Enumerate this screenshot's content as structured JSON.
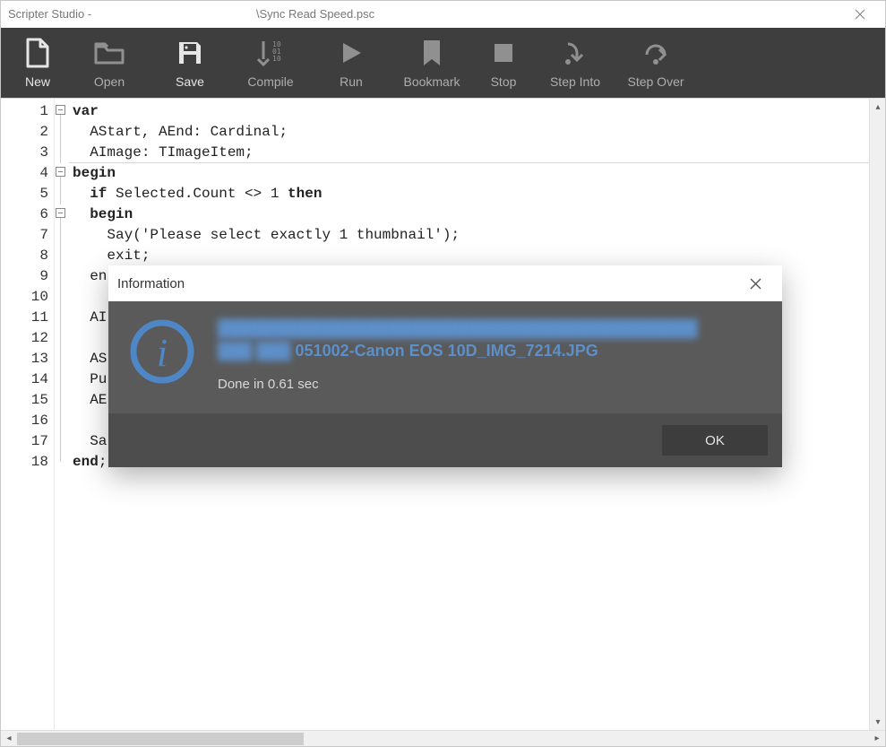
{
  "window": {
    "title_prefix": "Scripter Studio - ",
    "title_obscured": "████████████████",
    "title_suffix": "\\Sync Read Speed.psc"
  },
  "toolbar": [
    {
      "id": "new",
      "label": "New",
      "active": true
    },
    {
      "id": "open",
      "label": "Open",
      "active": false
    },
    {
      "id": "save",
      "label": "Save",
      "active": true
    },
    {
      "id": "compile",
      "label": "Compile",
      "active": false
    },
    {
      "id": "run",
      "label": "Run",
      "active": false
    },
    {
      "id": "bookmark",
      "label": "Bookmark",
      "active": false
    },
    {
      "id": "stop",
      "label": "Stop",
      "active": false
    },
    {
      "id": "stepinto",
      "label": "Step Into",
      "active": false
    },
    {
      "id": "stepover",
      "label": "Step Over",
      "active": false
    }
  ],
  "code_lines": [
    {
      "n": 1,
      "fold": "open",
      "html": "<span class='kw'>var</span>"
    },
    {
      "n": 2,
      "fold": "line",
      "html": "  AStart, AEnd: Cardinal;"
    },
    {
      "n": 3,
      "fold": "line",
      "html": "  AImage: TImageItem;",
      "hr": true
    },
    {
      "n": 4,
      "fold": "open",
      "html": "<span class='kw'>begin</span>"
    },
    {
      "n": 5,
      "fold": "line",
      "html": "  <span class='kw'>if</span> Selected.Count &lt;&gt; 1 <span class='kw'>then</span>"
    },
    {
      "n": 6,
      "fold": "open",
      "html": "  <span class='kw'>begin</span>"
    },
    {
      "n": 7,
      "fold": "line",
      "html": "    Say('Please select exactly 1 thumbnail');"
    },
    {
      "n": 8,
      "fold": "line",
      "html": "    exit;"
    },
    {
      "n": 9,
      "fold": "line",
      "html": "  en"
    },
    {
      "n": 10,
      "fold": "line",
      "html": ""
    },
    {
      "n": 11,
      "fold": "line",
      "html": "  AI"
    },
    {
      "n": 12,
      "fold": "line",
      "html": ""
    },
    {
      "n": 13,
      "fold": "line",
      "html": "  AS"
    },
    {
      "n": 14,
      "fold": "line",
      "html": "  Pu                                                                    yncRead"
    },
    {
      "n": 15,
      "fold": "line",
      "html": "  AE"
    },
    {
      "n": 16,
      "fold": "line",
      "html": ""
    },
    {
      "n": 17,
      "fold": "line",
      "html": "  Sa                                                                    AEnd -"
    },
    {
      "n": 18,
      "fold": "end",
      "html": "<span class='kw'>end</span>;"
    }
  ],
  "modal": {
    "title": "Information",
    "path_obscured_1": "██████████████████████████████████████████",
    "path_obscured_2": "███ ███",
    "filename": " 051002-Canon EOS 10D_IMG_7214.JPG",
    "done_text": "Done in 0.61 sec",
    "ok_label": "OK"
  }
}
